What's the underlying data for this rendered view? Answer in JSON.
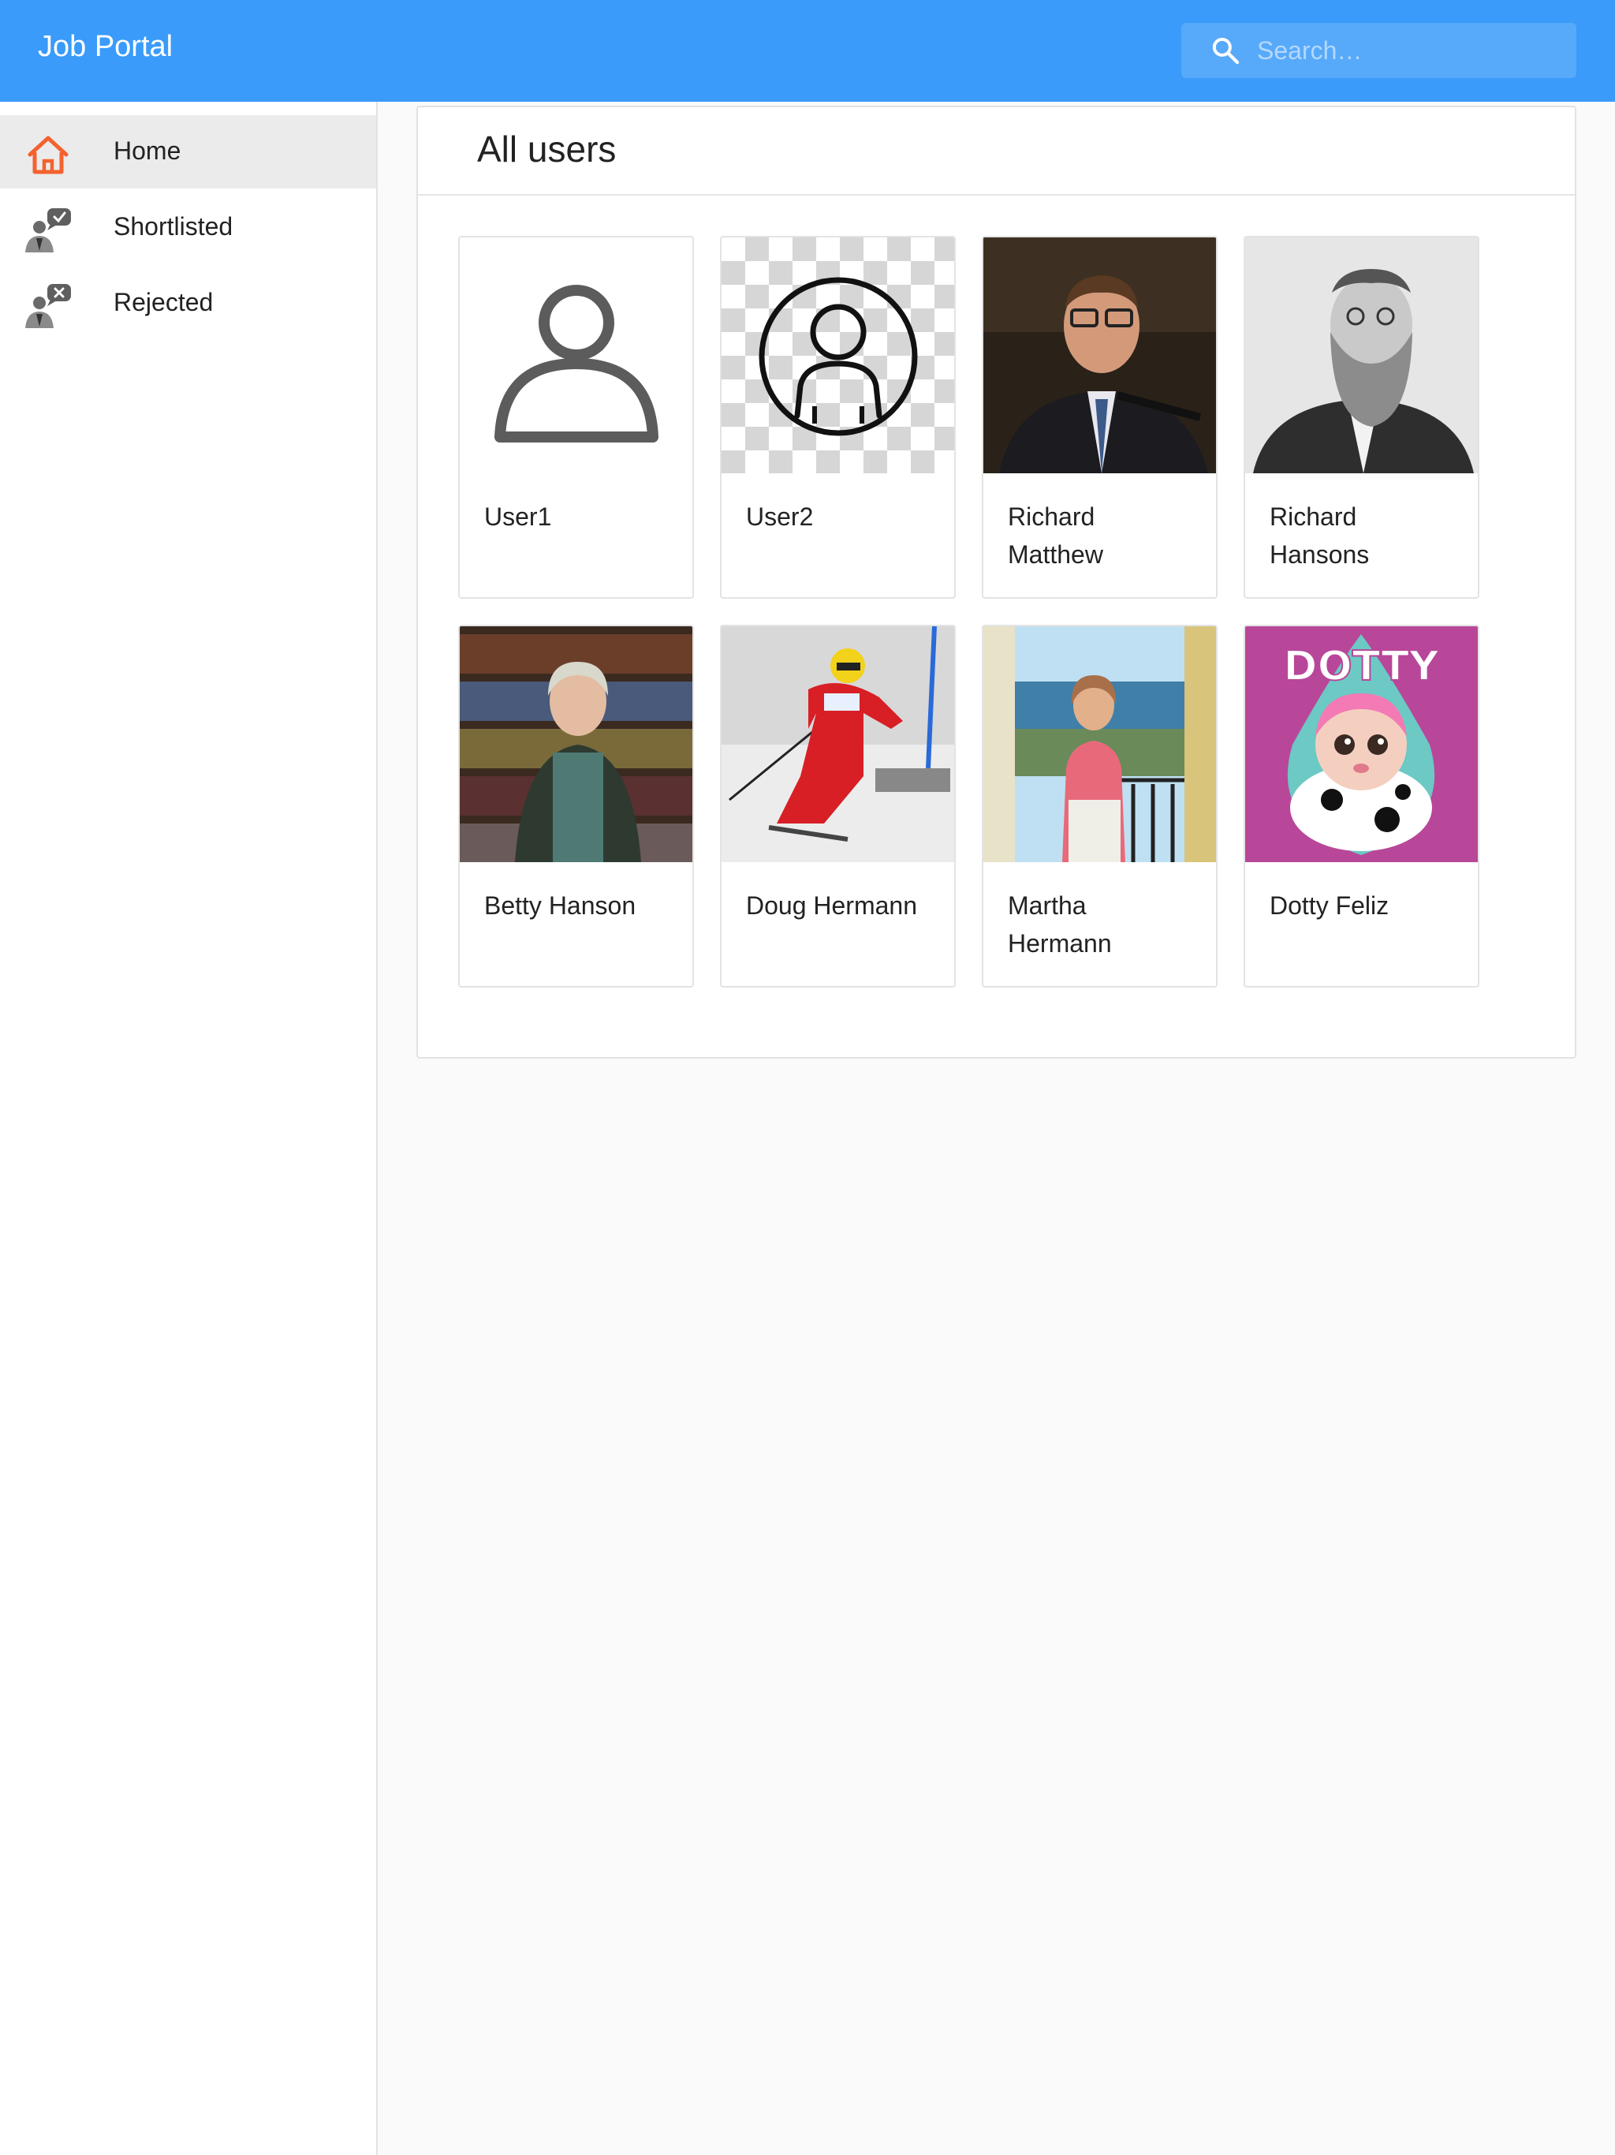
{
  "app": {
    "title": "Job Portal"
  },
  "search": {
    "placeholder": "Search…",
    "value": ""
  },
  "sidebar": {
    "items": [
      {
        "label": "Home",
        "icon": "home-icon",
        "active": true
      },
      {
        "label": "Shortlisted",
        "icon": "shortlisted-person-icon",
        "active": false
      },
      {
        "label": "Rejected",
        "icon": "rejected-person-icon",
        "active": false
      }
    ]
  },
  "main": {
    "title": "All users",
    "users": [
      {
        "name": "User1",
        "photo": "default-avatar-outline"
      },
      {
        "name": "User2",
        "photo": "default-avatar-circle"
      },
      {
        "name": "Richard Matthew",
        "photo": "photo-man-glasses-microphone"
      },
      {
        "name": "Richard Hansons",
        "photo": "photo-bearded-man-vintage"
      },
      {
        "name": "Betty Hanson",
        "photo": "photo-woman-bookshelf"
      },
      {
        "name": "Doug Hermann",
        "photo": "photo-skier"
      },
      {
        "name": "Martha Hermann",
        "photo": "photo-woman-balcony-sea"
      },
      {
        "name": "Dotty Feliz",
        "photo": "illustration-dotty-doll",
        "photo_text": "DOTTY"
      }
    ]
  },
  "colors": {
    "appbar": "#3a9bfa",
    "active_nav_bg": "#ebebeb",
    "home_icon": "#f4622d",
    "page_bg": "#fafafa"
  }
}
